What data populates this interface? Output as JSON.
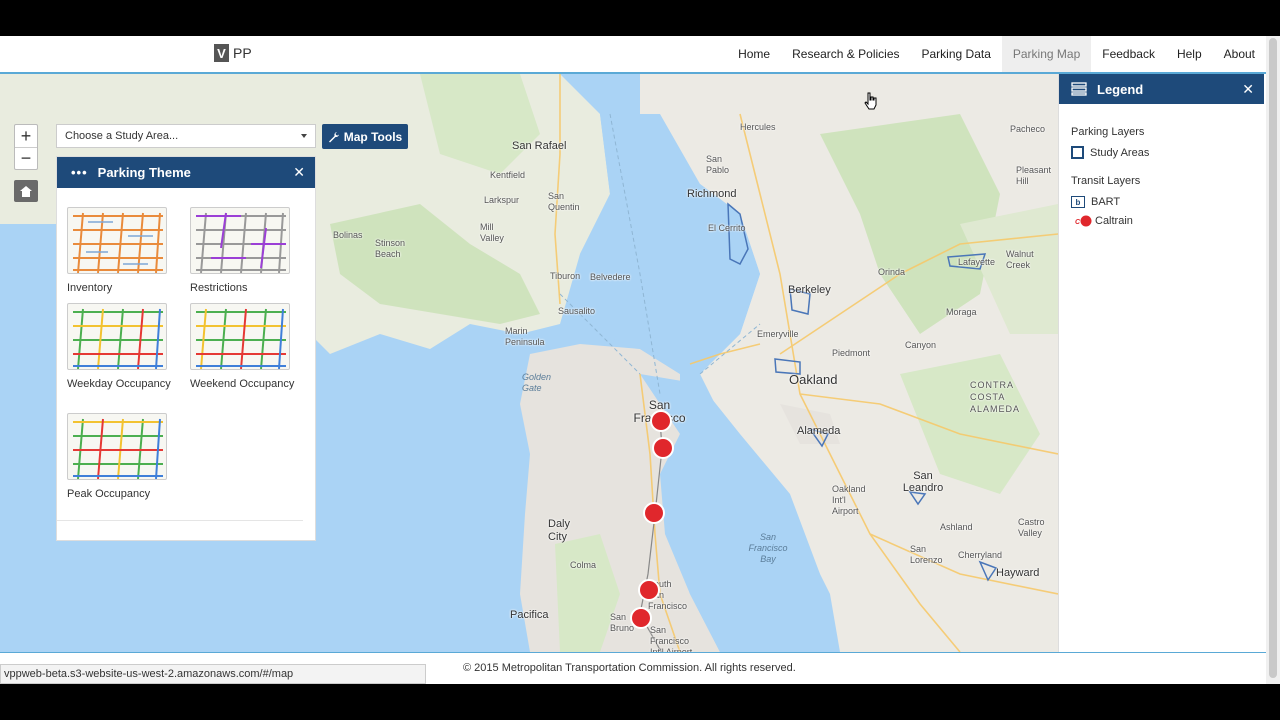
{
  "app": {
    "logo_mark": "V",
    "logo_text": "PP"
  },
  "nav": {
    "items": [
      {
        "label": "Home"
      },
      {
        "label": "Research & Policies"
      },
      {
        "label": "Parking Data"
      },
      {
        "label": "Parking Map",
        "active": true
      },
      {
        "label": "Feedback"
      },
      {
        "label": "Help"
      },
      {
        "label": "About"
      }
    ]
  },
  "map": {
    "zoom_in": "+",
    "zoom_out": "−",
    "study_area_placeholder": "Choose a Study Area...",
    "map_tools_label": "Map Tools",
    "labels": {
      "san_rafael": "San Rafael",
      "richmond": "Richmond",
      "berkeley": "Berkeley",
      "oakland": "Oakland",
      "san_francisco": "San Francisco",
      "alameda": "Alameda",
      "san_leandro": "San Leandro",
      "hayward": "Hayward",
      "daly_city": "Daly City",
      "pacifica": "Pacifica",
      "sausalito": "Sausalito",
      "tiburon": "Tiburon",
      "mill_valley": "Mill Valley",
      "larkspur": "Larkspur",
      "el_cerrito": "El Cerrito",
      "orinda": "Orinda",
      "moraga": "Moraga",
      "canyon": "Canyon",
      "walnut_creek": "Walnut Creek",
      "lafayette": "Lafayette",
      "castro_valley": "Castro Valley",
      "san_pablo": "San Pablo",
      "san_quentin": "San Quentin",
      "bolinas": "Bolinas",
      "stinson_beach": "Stinson Beach",
      "golden_gate": "Golden Gate",
      "sf_bay": "San Francisco Bay",
      "marin_peninsula": "Marin Peninsula",
      "oakland_intl": "Oakland Int'l Airport",
      "sfo": "San Francisco Int'l Airport",
      "south_sf": "South San Francisco",
      "san_bruno": "San Bruno",
      "colma": "Colma",
      "piedmont": "Piedmont",
      "kentfield": "Kentfield",
      "belvedere": "Belvedere",
      "emeryville": "Emeryville",
      "pleasant_hill": "Pleasant Hill",
      "contra_costa": "CONTRA COSTA ALAMEDA",
      "hercules": "Hercules",
      "pacheco": "Pacheco",
      "ashland": "Ashland",
      "cherryland": "Cherryland",
      "san_lorenzo": "San Lorenzo"
    }
  },
  "theme_panel": {
    "title": "Parking Theme",
    "themes": [
      {
        "label": "Inventory",
        "icon": "inventory-thumbnail"
      },
      {
        "label": "Restrictions",
        "icon": "restrictions-thumbnail"
      },
      {
        "label": "Weekday Occupancy",
        "icon": "weekday-occupancy-thumbnail"
      },
      {
        "label": "Weekend Occupancy",
        "icon": "weekend-occupancy-thumbnail"
      },
      {
        "label": "Peak Occupancy",
        "icon": "peak-occupancy-thumbnail"
      }
    ]
  },
  "legend": {
    "title": "Legend",
    "parking_layers_title": "Parking Layers",
    "study_areas_label": "Study Areas",
    "transit_layers_title": "Transit Layers",
    "bart_label": "BART",
    "caltrain_label": "Caltrain"
  },
  "footer": {
    "copyright": "© 2015 Metropolitan Transportation Commission. All rights reserved."
  },
  "status_bar": {
    "url": "vppweb-beta.s3-website-us-west-2.amazonaws.com/#/map"
  },
  "colors": {
    "brand_navy": "#1e4a7a",
    "accent_blue": "#5aa9d6",
    "water": "#aad3f5",
    "caltrain_red": "#e0272c"
  }
}
